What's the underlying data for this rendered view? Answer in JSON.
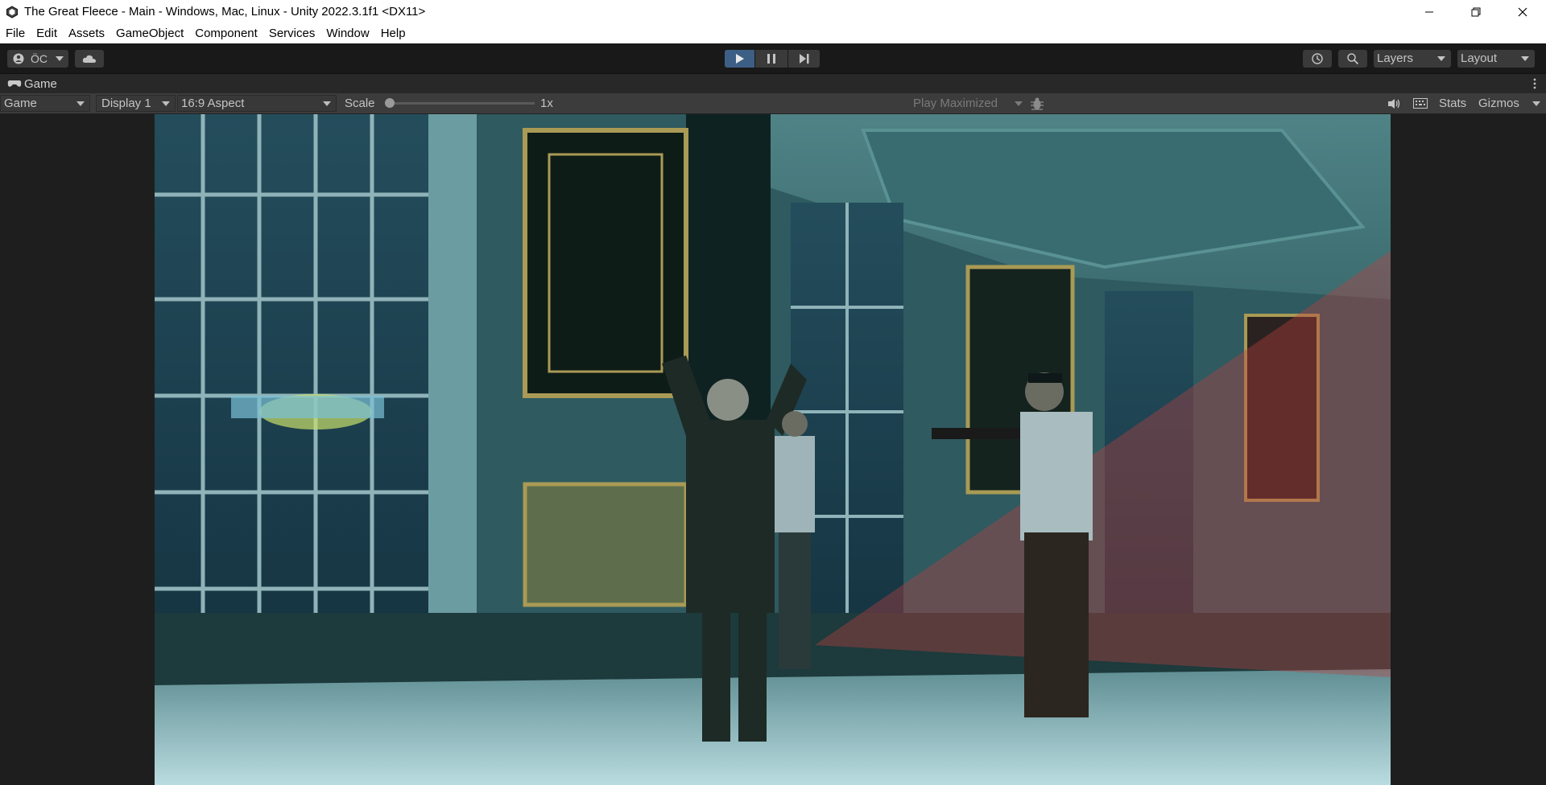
{
  "window": {
    "title": "The Great Fleece - Main - Windows, Mac, Linux - Unity 2022.3.1f1 <DX11>",
    "controls": [
      "minimize",
      "restore",
      "close"
    ]
  },
  "menu": [
    "File",
    "Edit",
    "Assets",
    "GameObject",
    "Component",
    "Services",
    "Window",
    "Help"
  ],
  "toolbar": {
    "account_label": "ÖC",
    "layers_label": "Layers",
    "layout_label": "Layout"
  },
  "game_tab": {
    "label": "Game"
  },
  "game_bar": {
    "view_mode": "Game",
    "display": "Display 1",
    "aspect": "16:9 Aspect",
    "scale_label": "Scale",
    "scale_value": "1x",
    "scale_level": 0.0,
    "play_mode": "Play Maximized",
    "stats_label": "Stats",
    "gizmos_label": "Gizmos"
  },
  "colors": {
    "editor_bg": "#1e1e1e",
    "toolbar_bg": "#191919",
    "play_active": "#3d5f86",
    "guard_vision": "#c04040"
  }
}
